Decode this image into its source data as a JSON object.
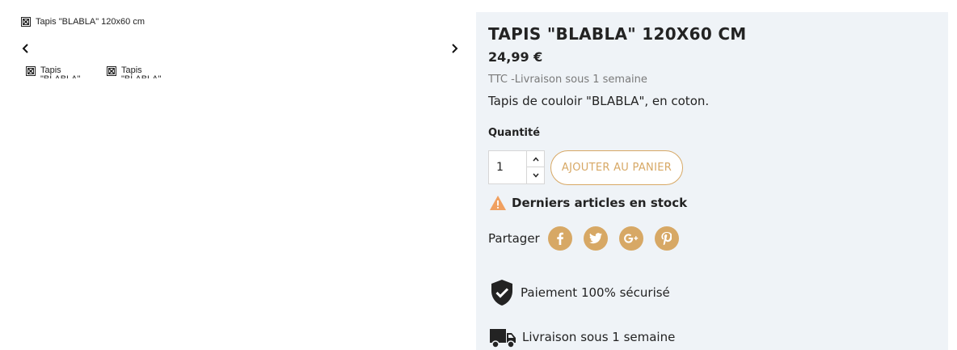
{
  "gallery": {
    "main_image_alt": "Tapis \"BLABLA\" 120x60 cm",
    "thumbnails": [
      {
        "alt": "Tapis \"BLABLA\""
      },
      {
        "alt": "Tapis \"BLABLA\""
      }
    ]
  },
  "product": {
    "title": "TAPIS \"BLABLA\" 120X60 CM",
    "price": "24,99 €",
    "tax_delivery": "TTC  -Livraison sous 1 semaine",
    "description": "Tapis de couloir \"BLABLA\", en coton.",
    "quantity_label": "Quantité",
    "quantity_value": "1",
    "add_to_cart": "AJOUTER AU PANIER",
    "stock_warning": "Derniers articles en stock",
    "share_label": "Partager"
  },
  "social": [
    {
      "name": "facebook-icon",
      "glyph": "f"
    },
    {
      "name": "twitter-icon",
      "glyph": "t"
    },
    {
      "name": "google-plus-icon",
      "glyph": "G+"
    },
    {
      "name": "pinterest-icon",
      "glyph": "P"
    }
  ],
  "reassurance": [
    {
      "icon": "shield-check-icon",
      "text": "Paiement 100% sécurisé"
    },
    {
      "icon": "truck-icon",
      "text": "Livraison sous 1 semaine"
    }
  ],
  "colors": {
    "accent": "#d7a865",
    "panel_bg": "#eff3f7",
    "warning": "#f0a060",
    "text": "#232323",
    "muted": "#7a7a7a"
  }
}
